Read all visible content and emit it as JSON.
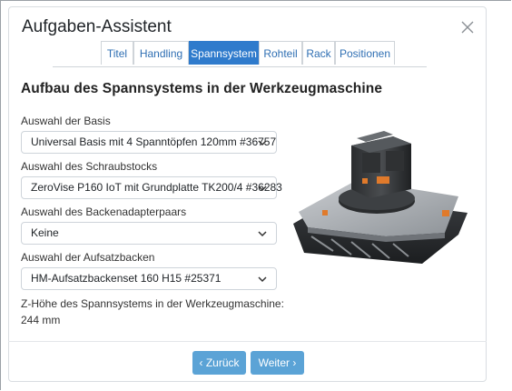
{
  "dialog": {
    "title": "Aufgaben-Assistent",
    "close_icon": "close-icon"
  },
  "tabs": [
    {
      "label": "Titel",
      "active": false
    },
    {
      "label": "Handling",
      "active": false
    },
    {
      "label": "Spannsystem",
      "active": true
    },
    {
      "label": "Rohteil",
      "active": false
    },
    {
      "label": "Rack",
      "active": false
    },
    {
      "label": "Positionen",
      "active": false
    }
  ],
  "section": {
    "title": "Aufbau des Spannsystems in der Werkzeugmaschine"
  },
  "fields": {
    "basis": {
      "label": "Auswahl der Basis",
      "value": "Universal Basis mit 4 Spanntöpfen 120mm #36757"
    },
    "schraubstock": {
      "label": "Auswahl des Schraubstocks",
      "value": "ZeroVise P160 IoT mit Grundplatte TK200/4 #36283"
    },
    "backenadapter": {
      "label": "Auswahl des Backenadapterpaars",
      "value": "Keine"
    },
    "aufsatzbacken": {
      "label": "Auswahl der Aufsatzbacken",
      "value": "HM-Aufsatzbackenset 160 H15 #25371"
    }
  },
  "info": {
    "line1": "Z-Höhe des Spannsystems in der Werkzeugmaschine:",
    "line2": "244 mm"
  },
  "footer": {
    "back_label": "Zurück",
    "next_label": "Weiter"
  },
  "colors": {
    "accent": "#2f7bcc",
    "button": "#5ba3d6"
  }
}
